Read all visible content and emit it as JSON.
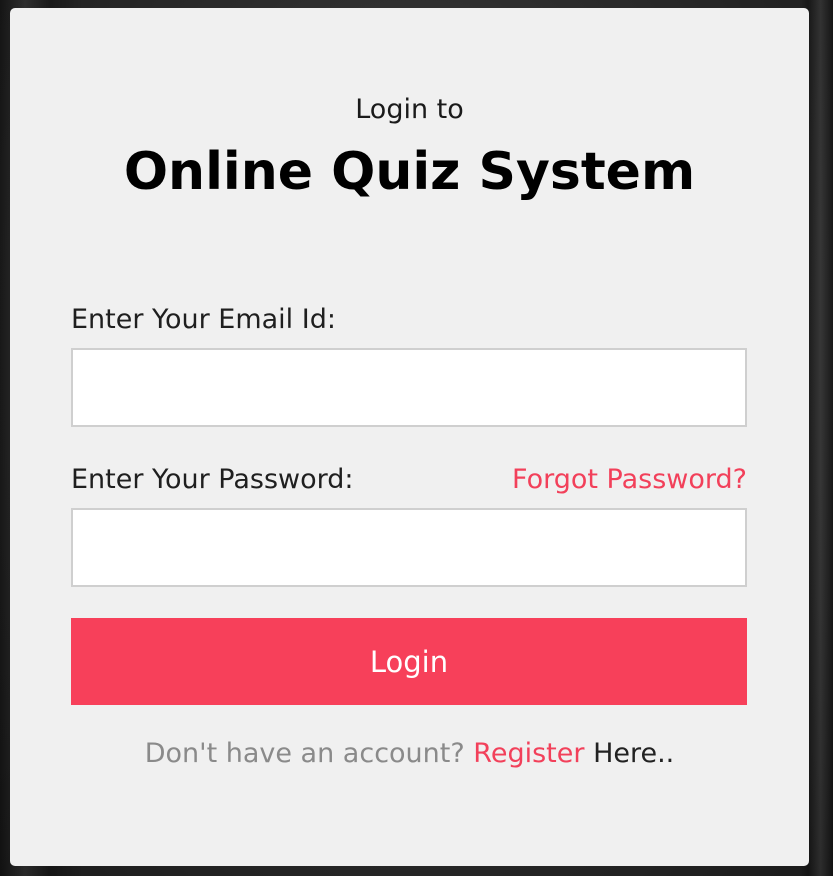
{
  "header": {
    "subtitle": "Login to",
    "title": "Online Quiz System"
  },
  "form": {
    "email_label": "Enter Your Email Id:",
    "email_value": "",
    "password_label": "Enter Your Password:",
    "password_value": "",
    "forgot_link": "Forgot Password?",
    "login_button": "Login"
  },
  "footer": {
    "prefix": "Don't have an account?",
    "register_link": "Register",
    "suffix": "Here.."
  },
  "colors": {
    "accent": "#f7405a",
    "card_bg": "#f0f0f0",
    "input_border": "#cfcfcf"
  }
}
